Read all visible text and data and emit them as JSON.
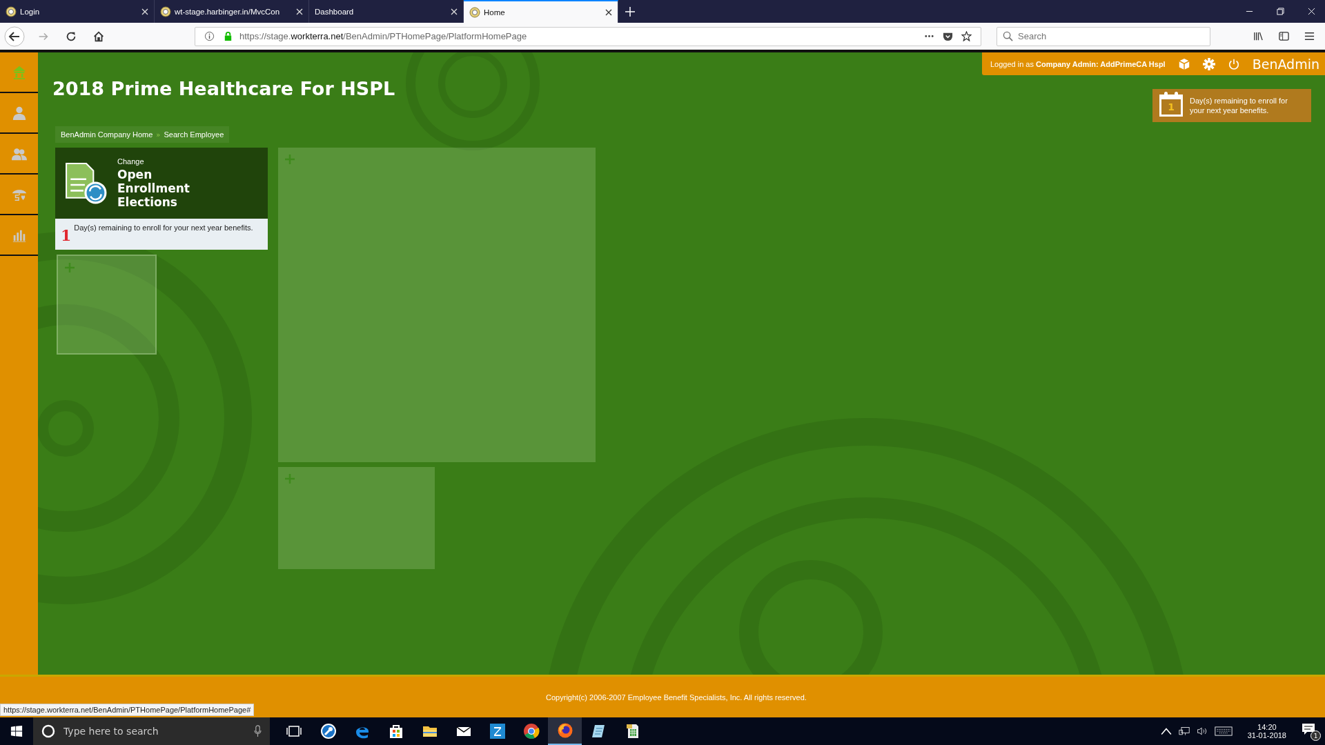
{
  "browser": {
    "tabs": [
      {
        "title": "Login",
        "kind": "site",
        "selected": false
      },
      {
        "title": "wt-stage.harbinger.in/MvcCon",
        "kind": "site",
        "selected": false
      },
      {
        "title": "Dashboard",
        "kind": "plain",
        "selected": false
      },
      {
        "title": "Home",
        "kind": "site",
        "selected": true
      }
    ],
    "address": {
      "prefix": "https://stage.",
      "domain": "workterra.net",
      "path": "/BenAdmin/PTHomePage/PlatformHomePage"
    },
    "search": {
      "placeholder": "Search"
    }
  },
  "header": {
    "logged_in_label": "Logged in as",
    "user": "Company Admin:  AddPrimeCA Hspl",
    "brand": "BenAdmin"
  },
  "sidebar": {
    "items": [
      {
        "kind": "home",
        "selected": true
      },
      {
        "kind": "person",
        "selected": false
      },
      {
        "kind": "people",
        "selected": false
      },
      {
        "kind": "umbrella",
        "selected": false
      },
      {
        "kind": "chart",
        "selected": false
      }
    ]
  },
  "page_title": "2018 Prime Healthcare For HSPL",
  "notice": {
    "count": "1",
    "text": "Day(s) remaining to enroll for your next year benefits."
  },
  "breadcrumb": {
    "items": [
      "BenAdmin Company Home",
      "Search Employee"
    ],
    "separator": "»"
  },
  "card": {
    "overline": "Change",
    "title": "Open Enrollment Elections",
    "count": "1",
    "note": "Day(s) remaining to enroll for your next year benefits."
  },
  "footer": {
    "copyright": "Copyright(c) 2006-2007 Employee Benefit Specialists, Inc. All rights reserved."
  },
  "status_url": "https://stage.workterra.net/BenAdmin/PTHomePage/PlatformHomePage#",
  "taskbar": {
    "search_placeholder": "Type here to search",
    "apps": [
      {
        "kind": "wrench",
        "selected": false
      },
      {
        "kind": "edge",
        "selected": false
      },
      {
        "kind": "store",
        "selected": false
      },
      {
        "kind": "folder",
        "selected": false
      },
      {
        "kind": "mail",
        "selected": false
      },
      {
        "kind": "z",
        "selected": false
      },
      {
        "kind": "chrome",
        "selected": false
      },
      {
        "kind": "firefox",
        "selected": true
      },
      {
        "kind": "notepad",
        "selected": false
      },
      {
        "kind": "sheet",
        "selected": false
      }
    ],
    "time": "14:20",
    "date": "31-01-2018",
    "notifications": "1"
  }
}
